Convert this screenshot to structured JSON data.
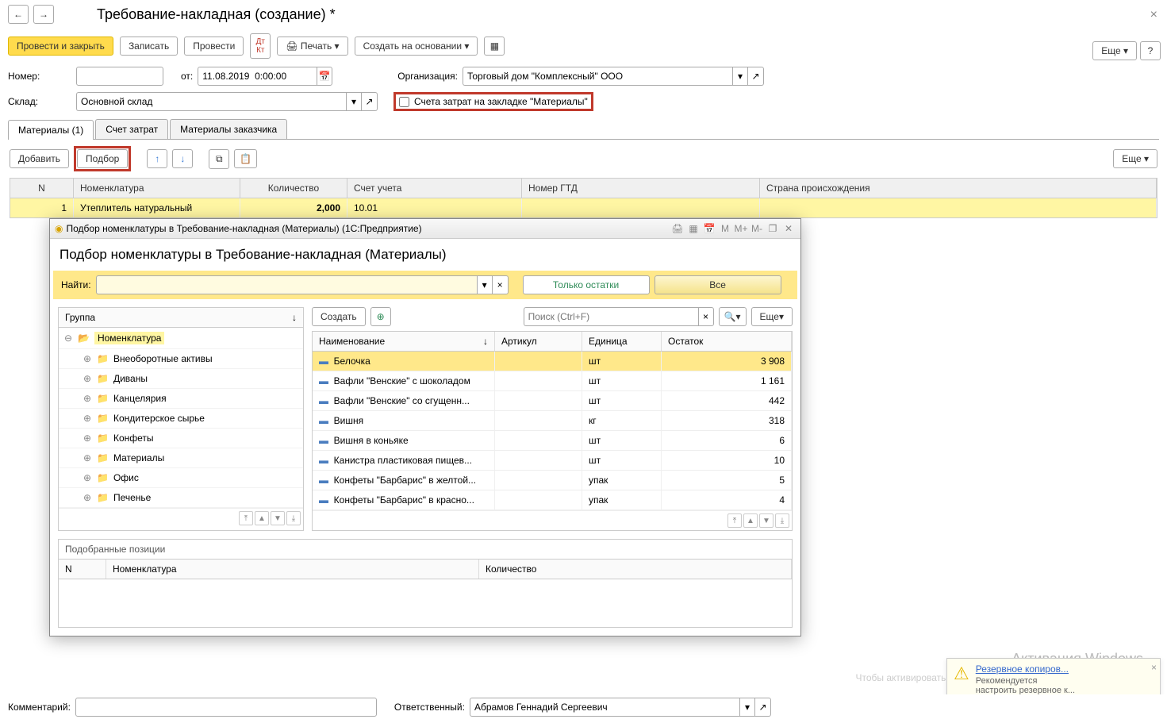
{
  "title": "Требование-накладная (создание) *",
  "nav": {
    "back": "←",
    "fwd": "→"
  },
  "actions": {
    "post_close": "Провести и закрыть",
    "save": "Записать",
    "post": "Провести",
    "print": "Печать",
    "create_based": "Создать на основании",
    "more": "Еще",
    "help": "?"
  },
  "form": {
    "number_label": "Номер:",
    "number": "",
    "from_label": "от:",
    "date": "11.08.2019  0:00:00",
    "org_label": "Организация:",
    "org": "Торговый дом \"Комплексный\" ООО",
    "warehouse_label": "Склад:",
    "warehouse": "Основной склад",
    "cost_checkbox_label": "Счета затрат на закладке \"Материалы\""
  },
  "tabs": {
    "materials": "Материалы (1)",
    "cost": "Счет затрат",
    "customer_mat": "Материалы заказчика"
  },
  "sub": {
    "add": "Добавить",
    "pick": "Подбор"
  },
  "table": {
    "cols": {
      "n": "N",
      "nom": "Номенклатура",
      "qty": "Количество",
      "account": "Счет учета",
      "gtd": "Номер ГТД",
      "country": "Страна происхождения"
    },
    "row": {
      "n": "1",
      "nom": "Утеплитель натуральный",
      "qty": "2,000",
      "account": "10.01",
      "gtd": "",
      "country": ""
    }
  },
  "modal": {
    "winTitle": "Подбор номенклатуры в Требование-накладная (Материалы)  (1С:Предприятие)",
    "head": "Подбор номенклатуры в Требование-накладная (Материалы)",
    "find_label": "Найти:",
    "find_value": "",
    "only_stock": "Только остатки",
    "all": "Все",
    "group_col": "Группа",
    "tree": {
      "root": "Номенклатура",
      "children": [
        "Внеоборотные активы",
        "Диваны",
        "Канцелярия",
        "Кондитерское сырье",
        "Конфеты",
        "Материалы",
        "Офис",
        "Печенье"
      ]
    },
    "list_toolbar": {
      "create": "Создать",
      "search_ph": "Поиск (Ctrl+F)",
      "more": "Еще"
    },
    "list_cols": {
      "name": "Наименование",
      "sku": "Артикул",
      "unit": "Единица",
      "stock": "Остаток"
    },
    "rows": [
      {
        "name": "Белочка",
        "sku": "",
        "unit": "шт",
        "stock": "3 908"
      },
      {
        "name": "Вафли \"Венские\" с шоколадом",
        "sku": "",
        "unit": "шт",
        "stock": "1 161"
      },
      {
        "name": "Вафли \"Венские\" со сгущенн...",
        "sku": "",
        "unit": "шт",
        "stock": "442"
      },
      {
        "name": "Вишня",
        "sku": "",
        "unit": "кг",
        "stock": "318"
      },
      {
        "name": "Вишня в коньяке",
        "sku": "",
        "unit": "шт",
        "stock": "6"
      },
      {
        "name": "Канистра пластиковая пищев...",
        "sku": "",
        "unit": "шт",
        "stock": "10"
      },
      {
        "name": "Конфеты \"Барбарис\" в желтой...",
        "sku": "",
        "unit": "упак",
        "stock": "5"
      },
      {
        "name": "Конфеты \"Барбарис\" в красно...",
        "sku": "",
        "unit": "упак",
        "stock": "4"
      }
    ],
    "picked_title": "Подобранные позиции",
    "picked_cols": {
      "n": "N",
      "nom": "Номенклатура",
      "qty": "Количество"
    }
  },
  "bottom": {
    "comment_label": "Комментарий:",
    "comment": "",
    "resp_label": "Ответственный:",
    "resp": "Абрамов Геннадий Сергеевич"
  },
  "watermark": {
    "l1": "Активация Windows",
    "l2": "Чтобы активировать Windows, перейдите в раздел \"Параметры\"."
  },
  "notif": {
    "title": "Резервное копиров...",
    "body1": "Рекомендуется",
    "body2": "настроить резервное к..."
  }
}
